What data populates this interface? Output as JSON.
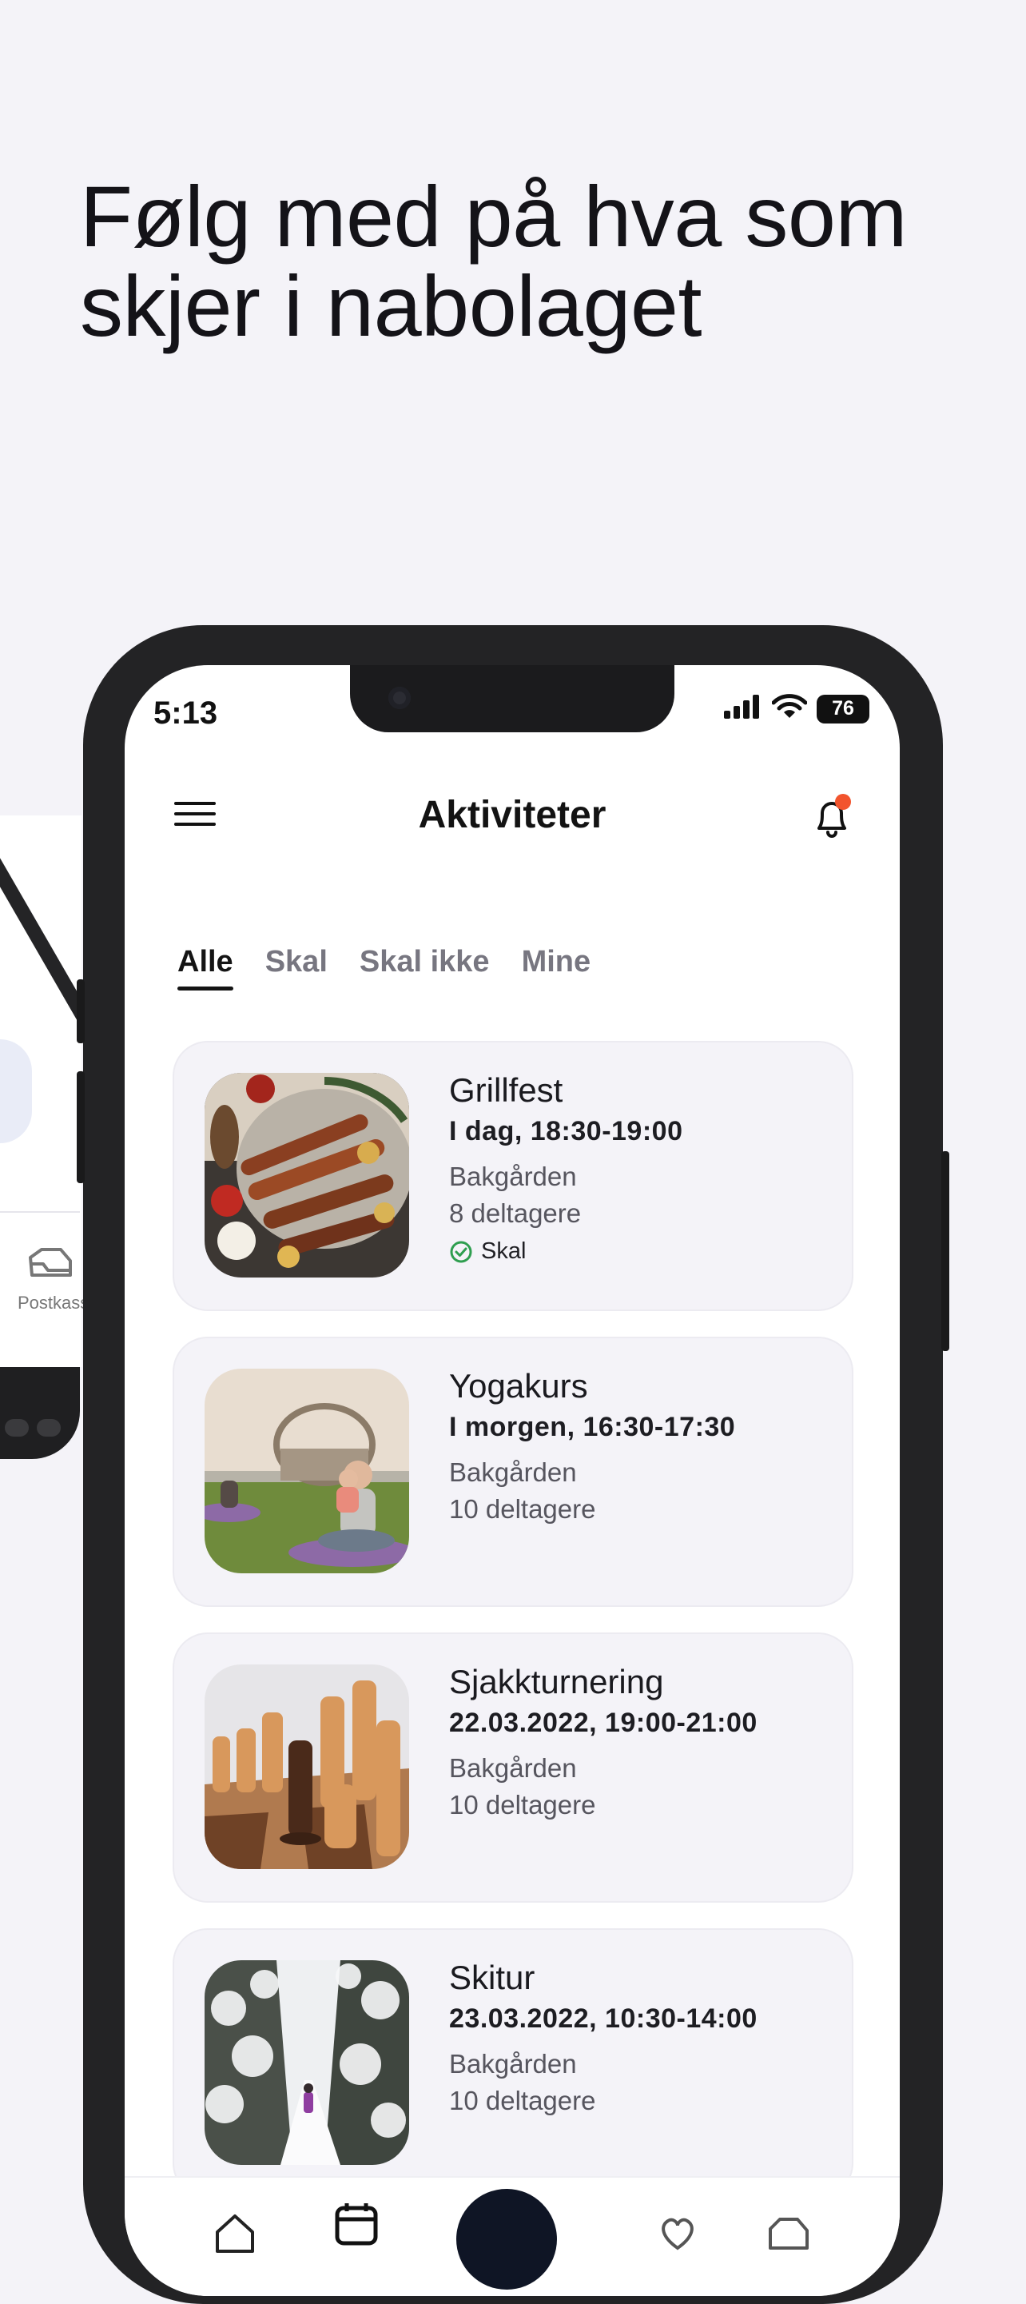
{
  "headline": "Følg med på hva som skjer i nabolaget",
  "background_phone": {
    "mail_label": "Postkasse"
  },
  "status_bar": {
    "time": "5:13",
    "battery": "76"
  },
  "header": {
    "title": "Aktiviteter",
    "has_notification": true
  },
  "tabs": [
    {
      "label": "Alle",
      "active": true
    },
    {
      "label": "Skal",
      "active": false
    },
    {
      "label": "Skal ikke",
      "active": false
    },
    {
      "label": "Mine",
      "active": false
    }
  ],
  "activities": [
    {
      "name": "Grillfest",
      "when": "I dag, 18:30-19:00",
      "place": "Bakgården",
      "participants": "8 deltagere",
      "rsvp": "Skal",
      "image": "bbq"
    },
    {
      "name": "Yogakurs",
      "when": "I morgen, 16:30-17:30",
      "place": "Bakgården",
      "participants": "10 deltagere",
      "rsvp": "",
      "image": "yoga"
    },
    {
      "name": "Sjakkturnering",
      "when": "22.03.2022, 19:00-21:00",
      "place": "Bakgården",
      "participants": "10 deltagere",
      "rsvp": "",
      "image": "chess"
    },
    {
      "name": "Skitur",
      "when": "23.03.2022, 10:30-14:00",
      "place": "Bakgården",
      "participants": "10 deltagere",
      "rsvp": "",
      "image": "ski"
    }
  ],
  "icons": {
    "menu": "hamburger-icon",
    "notifications": "bell-icon",
    "rsvp": "check-circle-icon",
    "tabbar": [
      "home-icon",
      "calendar-icon",
      "add-icon",
      "heart-icon",
      "mail-icon"
    ]
  },
  "colors": {
    "background": "#f4f3f8",
    "card": "#f4f3f8",
    "notification_dot": "#f2542d",
    "rsvp_check": "#2e9e4f",
    "fab": "#0f1525"
  }
}
